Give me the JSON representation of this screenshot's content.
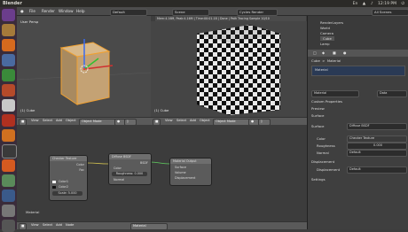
{
  "window": {
    "title": "Blender"
  },
  "system_tray": {
    "time": "12:19 PM",
    "indicators": [
      "En",
      "wifi",
      "volume"
    ]
  },
  "menubar": {
    "items": [
      "File",
      "Render",
      "Window",
      "Help"
    ],
    "screen": "Default",
    "scene": "Scene",
    "engine": "Cycles Render",
    "stats": "Mem:4.16M, Peak:4.16M | Time:00:01.18 | Done | Path Tracing Sample 10/10",
    "layout": "All Scenes"
  },
  "viewport_left": {
    "label": "User Persp",
    "object_label": "(1) Cube",
    "mode": "Object Mode",
    "view": "View",
    "select": "Select",
    "add": "Add",
    "object": "Object"
  },
  "viewport_right": {
    "object_label": "(1) Cube",
    "mode": "Object Mode",
    "view": "View",
    "select": "Select",
    "add": "Add",
    "object": "Object"
  },
  "node_editor": {
    "nodes": [
      {
        "title": "Checker Texture",
        "outputs": [
          "Color",
          "Fac"
        ],
        "inputs": [
          "Color1",
          "Color2",
          "Scale: 5.000"
        ]
      },
      {
        "title": "Diffuse BSDF",
        "outputs": [
          "BSDF"
        ],
        "inputs": [
          "Color",
          "Roughness: 0.000",
          "Normal"
        ]
      },
      {
        "title": "Material Output",
        "inputs": [
          "Surface",
          "Volume",
          "Displacement"
        ]
      }
    ],
    "footer_label": "Material",
    "header": {
      "view": "View",
      "select": "Select",
      "add": "Add",
      "node": "Node",
      "material": "Material"
    }
  },
  "outliner": {
    "items": [
      "RenderLayers",
      "World",
      "Camera",
      "Cube",
      "Lamp"
    ]
  },
  "properties": {
    "breadcrumb": [
      "Cube",
      "Material"
    ],
    "slot": "Material",
    "material_name": "Material",
    "data_label": "Data",
    "panels": [
      "Custom Properties",
      "Preview",
      "Surface",
      "Displacement",
      "Settings"
    ],
    "surface": {
      "label": "Surface",
      "value": "Diffuse BSDF"
    },
    "color": {
      "label": "Color",
      "value": "Checker Texture"
    },
    "roughness": {
      "label": "Roughness",
      "value": "0.000"
    },
    "normal": {
      "label": "Normal",
      "value": "Default"
    },
    "displacement": {
      "label": "Displacement",
      "value": "Default"
    }
  }
}
